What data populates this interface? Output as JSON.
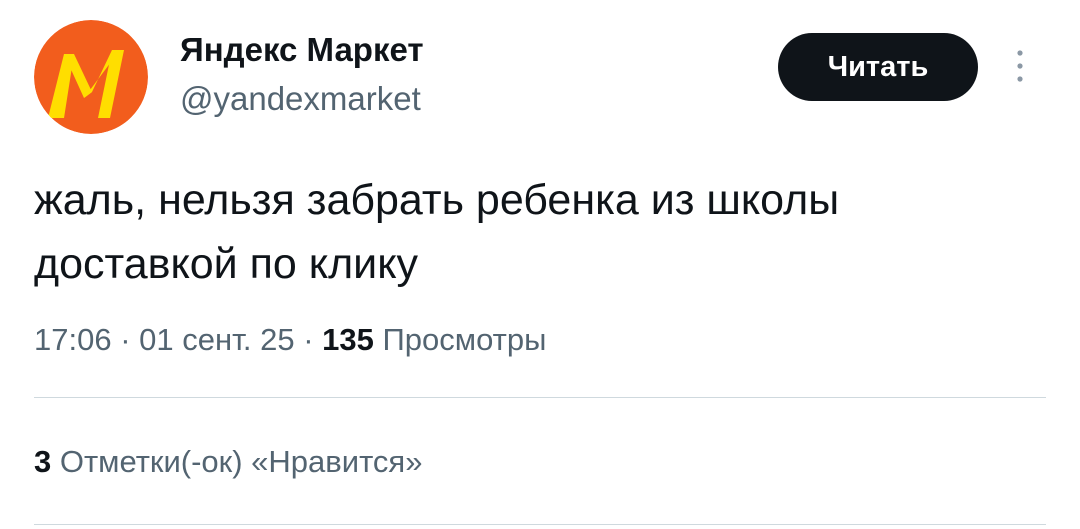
{
  "author": {
    "name": "Яндекс Маркет",
    "handle": "@yandexmarket",
    "avatar_colors": {
      "background": "#f25d1d",
      "logo": "#ffde00"
    }
  },
  "follow_button": {
    "label": "Читать"
  },
  "more_icon": "vertical-ellipsis-icon",
  "tweet": {
    "text_line_1": "жаль, нельзя забрать ребенка из школы",
    "text_line_2": "доставкой по клику"
  },
  "meta": {
    "time": "17:06",
    "separator": " · ",
    "date": "01 сент. 25",
    "views_count": "135",
    "views_label": "Просмотры"
  },
  "stats": {
    "likes_count": "3",
    "likes_label": "Отметки(-ок) «Нравится»"
  },
  "colors": {
    "text_primary": "#0f1419",
    "text_secondary": "#536471",
    "divider": "#cfd9de",
    "button_bg": "#0f1419",
    "button_text": "#ffffff"
  }
}
